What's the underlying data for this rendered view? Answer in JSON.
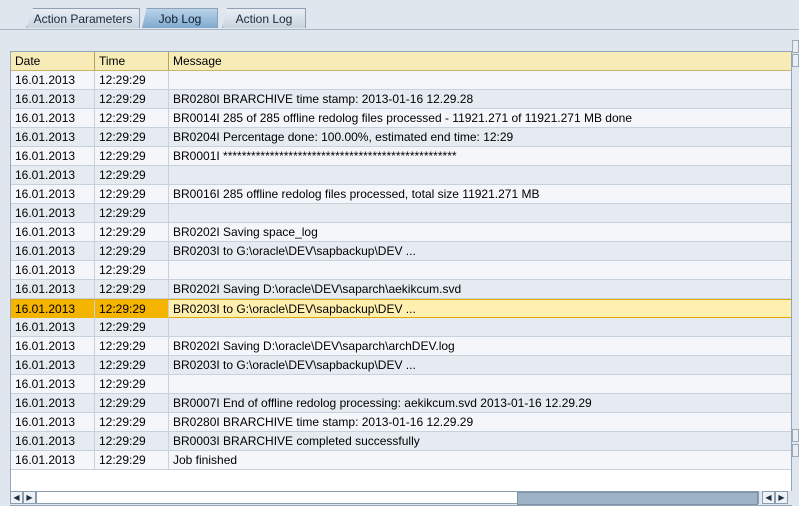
{
  "tabs": [
    {
      "label": "Action Parameters",
      "active": false
    },
    {
      "label": "Job Log",
      "active": true
    },
    {
      "label": "Action Log",
      "active": false
    }
  ],
  "table": {
    "columns": [
      "Date",
      "Time",
      "Message"
    ],
    "rows": [
      {
        "date": "16.01.2013",
        "time": "12:29:29",
        "message": ""
      },
      {
        "date": "16.01.2013",
        "time": "12:29:29",
        "message": "BR0280I BRARCHIVE time stamp: 2013-01-16 12.29.28"
      },
      {
        "date": "16.01.2013",
        "time": "12:29:29",
        "message": "BR0014I 285 of 285 offline redolog files processed - 11921.271 of 11921.271 MB done"
      },
      {
        "date": "16.01.2013",
        "time": "12:29:29",
        "message": "BR0204I Percentage done: 100.00%, estimated end time: 12:29"
      },
      {
        "date": "16.01.2013",
        "time": "12:29:29",
        "message": "BR0001I **************************************************"
      },
      {
        "date": "16.01.2013",
        "time": "12:29:29",
        "message": ""
      },
      {
        "date": "16.01.2013",
        "time": "12:29:29",
        "message": "BR0016I 285 offline redolog files processed, total size 11921.271 MB"
      },
      {
        "date": "16.01.2013",
        "time": "12:29:29",
        "message": ""
      },
      {
        "date": "16.01.2013",
        "time": "12:29:29",
        "message": "BR0202I Saving space_log"
      },
      {
        "date": "16.01.2013",
        "time": "12:29:29",
        "message": "BR0203I to G:\\oracle\\DEV\\sapbackup\\DEV ..."
      },
      {
        "date": "16.01.2013",
        "time": "12:29:29",
        "message": ""
      },
      {
        "date": "16.01.2013",
        "time": "12:29:29",
        "message": "BR0202I Saving D:\\oracle\\DEV\\saparch\\aekikcum.svd"
      },
      {
        "date": "16.01.2013",
        "time": "12:29:29",
        "message": "BR0203I to G:\\oracle\\DEV\\sapbackup\\DEV ...",
        "selected": true
      },
      {
        "date": "16.01.2013",
        "time": "12:29:29",
        "message": ""
      },
      {
        "date": "16.01.2013",
        "time": "12:29:29",
        "message": "BR0202I Saving D:\\oracle\\DEV\\saparch\\archDEV.log"
      },
      {
        "date": "16.01.2013",
        "time": "12:29:29",
        "message": "BR0203I to G:\\oracle\\DEV\\sapbackup\\DEV ..."
      },
      {
        "date": "16.01.2013",
        "time": "12:29:29",
        "message": ""
      },
      {
        "date": "16.01.2013",
        "time": "12:29:29",
        "message": "BR0007I End of offline redolog processing: aekikcum.svd 2013-01-16 12.29.29"
      },
      {
        "date": "16.01.2013",
        "time": "12:29:29",
        "message": "BR0280I BRARCHIVE time stamp: 2013-01-16 12.29.29"
      },
      {
        "date": "16.01.2013",
        "time": "12:29:29",
        "message": "BR0003I BRARCHIVE completed successfully"
      },
      {
        "date": "16.01.2013",
        "time": "12:29:29",
        "message": "Job finished"
      }
    ]
  },
  "colors": {
    "header_bg": "#f7ebb8",
    "selected_bg": "#fff0b0",
    "selected_key_bg": "#f4b400",
    "active_tab": "#7fa9cf"
  },
  "icons": {
    "scroll_left": "triangle-left",
    "scroll_right": "triangle-right"
  }
}
